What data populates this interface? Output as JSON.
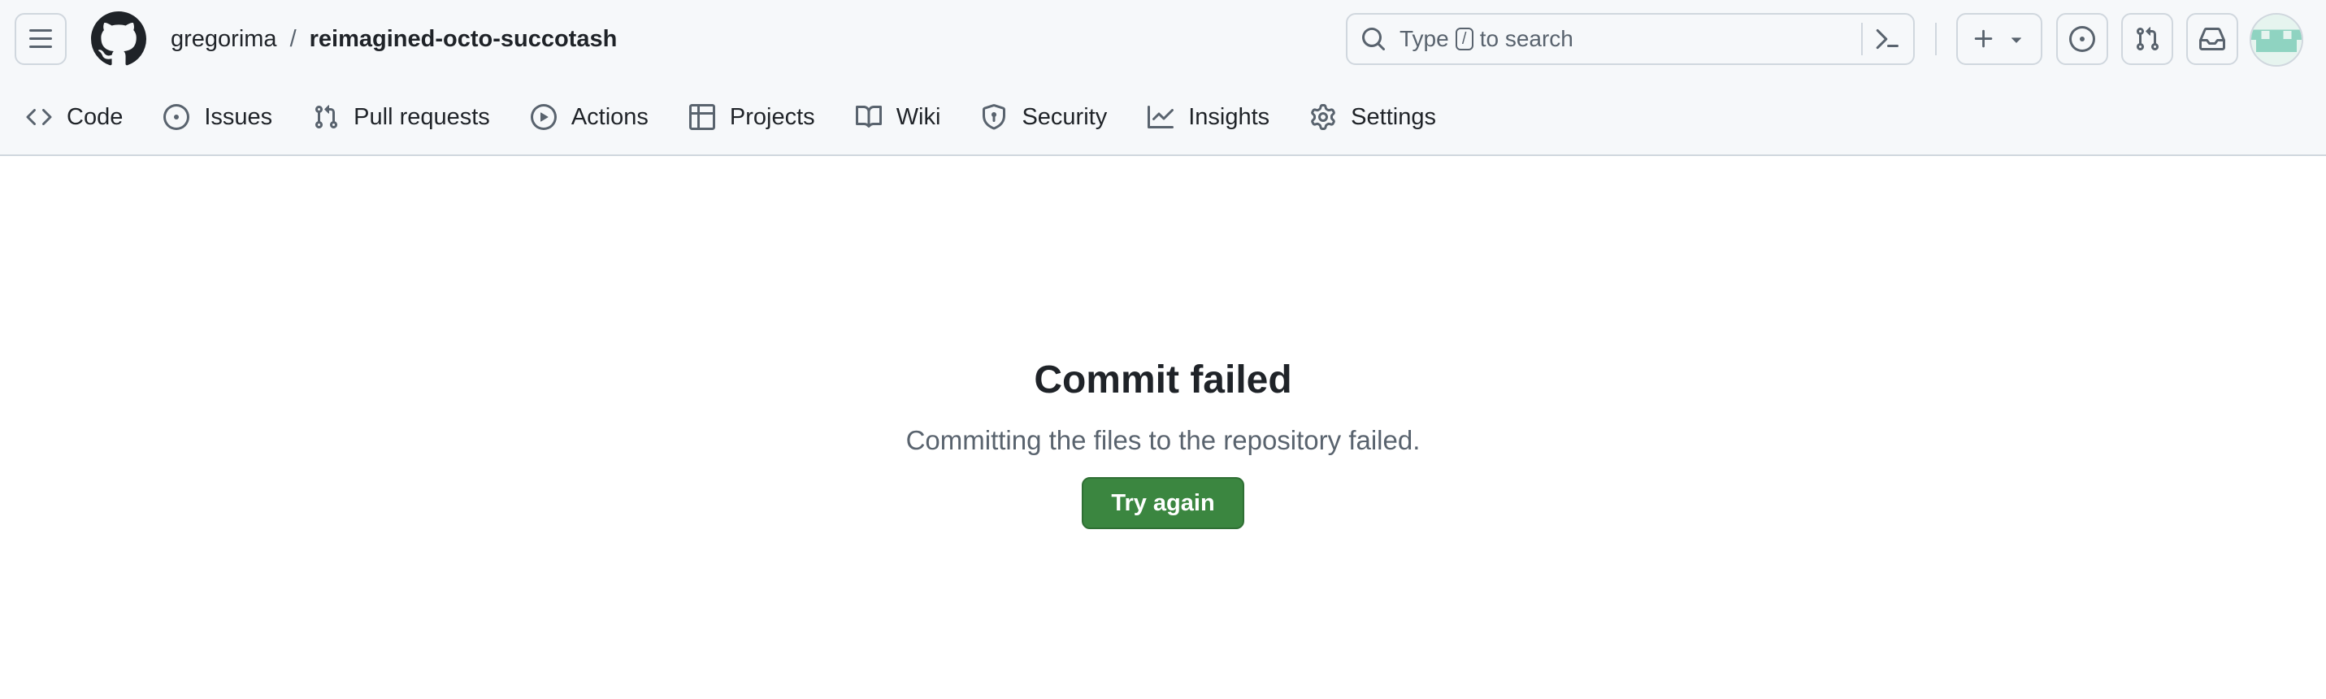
{
  "breadcrumb": {
    "owner": "gregorima",
    "separator": "/",
    "repo": "reimagined-octo-succotash"
  },
  "search": {
    "text_before": "Type",
    "key": "/",
    "text_after": "to search"
  },
  "nav": {
    "items": [
      {
        "label": "Code",
        "icon": "code-icon"
      },
      {
        "label": "Issues",
        "icon": "issue-icon"
      },
      {
        "label": "Pull requests",
        "icon": "pull-request-icon"
      },
      {
        "label": "Actions",
        "icon": "play-icon"
      },
      {
        "label": "Projects",
        "icon": "table-icon"
      },
      {
        "label": "Wiki",
        "icon": "book-icon"
      },
      {
        "label": "Security",
        "icon": "shield-icon"
      },
      {
        "label": "Insights",
        "icon": "graph-icon"
      },
      {
        "label": "Settings",
        "icon": "gear-icon"
      }
    ]
  },
  "main": {
    "title": "Commit failed",
    "message": "Committing the files to the repository failed.",
    "retry_label": "Try again"
  },
  "colors": {
    "accent": "#3b8640",
    "header_bg": "#f6f8fa",
    "muted_text": "#59636e"
  }
}
